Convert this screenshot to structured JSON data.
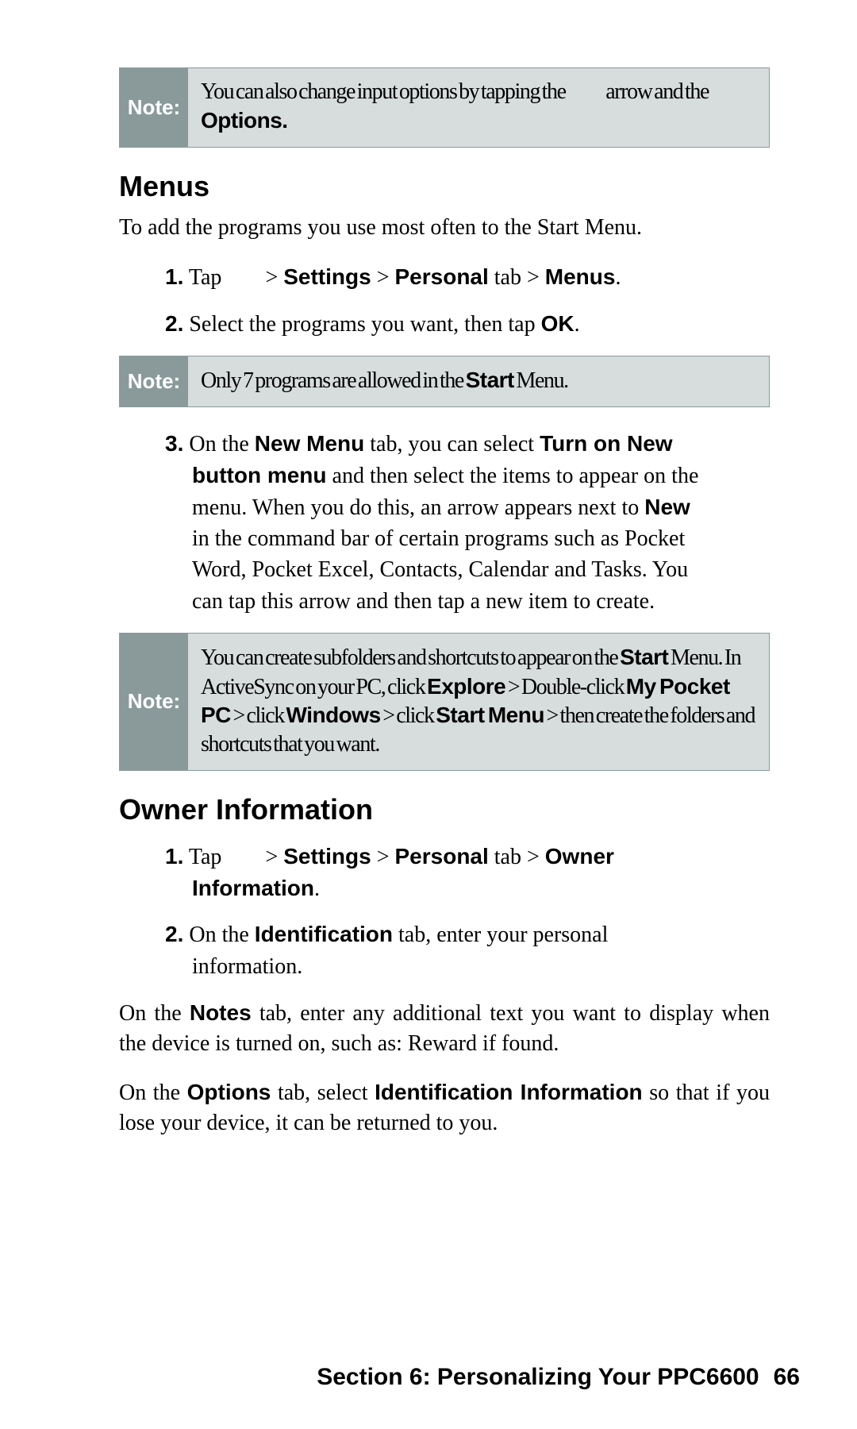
{
  "note1": {
    "label": "Note:",
    "pre": "You can also change input options by tapping the ",
    "mid": "arrow and the ",
    "bold": "Options."
  },
  "menus": {
    "heading": "Menus",
    "intro": "To add the programs you use most often to the Start Menu.",
    "step1": {
      "num": "1.",
      "w1": "Tap",
      "w2": " > ",
      "b1": "Settings",
      "w3": " > ",
      "b2": "Personal",
      "w4": " tab > ",
      "b3": "Menus",
      "w5": "."
    },
    "step2": {
      "num": "2.",
      "t1": "Select the programs you want, then tap ",
      "b1": "OK",
      "t2": "."
    },
    "note2": {
      "label": "Note:",
      "t1": "Only 7 programs are allowed in the ",
      "b1": "Start",
      "t2": " Menu."
    },
    "step3": {
      "num": "3.",
      "t1": "On the ",
      "b1": "New Menu",
      "t2": " tab, you can select ",
      "b2": "Turn on New button menu",
      "t3": " and then select the items to appear on the menu. When you do this, an arrow appears next to ",
      "b3": "New",
      "t4": " in the command bar of certain programs such as Pocket Word, Pocket Excel, Contacts, Calendar and Tasks. You can tap this arrow and then tap a new item to create."
    },
    "note3": {
      "label": "Note:",
      "t1": "You can create subfolders and shortcuts to appear on the ",
      "b1": "Start",
      "t2": " Menu. In ActiveSync on your PC, click ",
      "b2": "Explore",
      "t3": " >   Double-click ",
      "b3": "My Pocket PC",
      "t4": " >   click ",
      "b4": "Windows",
      "t5": " >   click ",
      "b5": "Start Menu",
      "t6": " >   then create the folders and shortcuts that you want."
    }
  },
  "owner": {
    "heading": "Owner Information",
    "step1": {
      "num": "1.",
      "w1": "Tap",
      "w2": " > ",
      "b1": "Settings",
      "w3": " > ",
      "b2": "Personal",
      "w4": " tab > ",
      "b3": "Owner Information",
      "w5": "."
    },
    "step2": {
      "num": "2.",
      "t1": "On the ",
      "b1": "Identification",
      "t2": " tab, enter your personal information."
    },
    "p_notes": {
      "t1": "On the ",
      "b1": "Notes",
      "t2": " tab, enter any additional text you want to display when the device is turned on, such as: Reward if found."
    },
    "p_options": {
      "t1": "On the ",
      "b1": "Options",
      "t2": " tab, select ",
      "b2": "Identification Information",
      "t3": " so that if you lose your device, it can be returned to you."
    }
  },
  "footer": {
    "section": "Section 6: Personalizing Your PPC6600",
    "page": "66"
  }
}
